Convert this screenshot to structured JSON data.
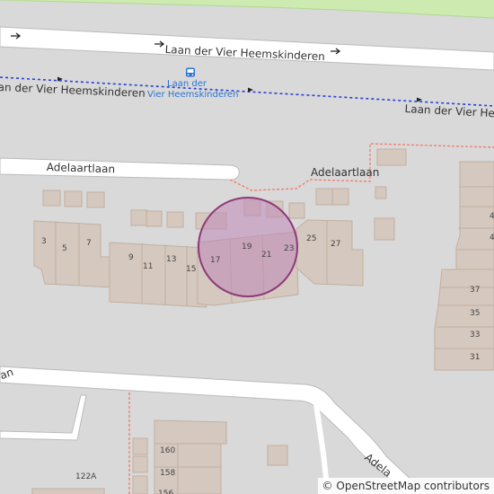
{
  "streets": {
    "top_road": "Laan der Vier Heemskinderen",
    "bus_route_left": "an der Vier Heemskinderen",
    "bus_route_right": "Laan der Vier Heemskindere",
    "adelaart_left": "Adelaartlaan",
    "adelaart_right": "Adelaartlaan",
    "bottom_left": "an",
    "bottom_right": "Adela"
  },
  "bus_stop": {
    "icon": "bus-stop-icon",
    "name_line1": "Laan der",
    "name_line2": "Vier Heemskinderen"
  },
  "house_numbers": [
    "3",
    "5",
    "7",
    "9",
    "11",
    "13",
    "15",
    "17",
    "19",
    "21",
    "23",
    "25",
    "27",
    "4",
    "4",
    "37",
    "35",
    "33",
    "31",
    "160",
    "158",
    "156",
    "122A"
  ],
  "attribution": {
    "symbol": "©",
    "text": "OpenStreetMap contributors"
  },
  "colors": {
    "background": "#d9d9d9",
    "building": "#d5c8be",
    "building_outline": "#c1b0a3",
    "road": "#ffffff",
    "park": "#cdebb0",
    "bus_route": "#2b3fd6",
    "path_red": "#f08070",
    "marker_fill": "#c088b8",
    "marker_stroke": "#8e3a7a"
  }
}
